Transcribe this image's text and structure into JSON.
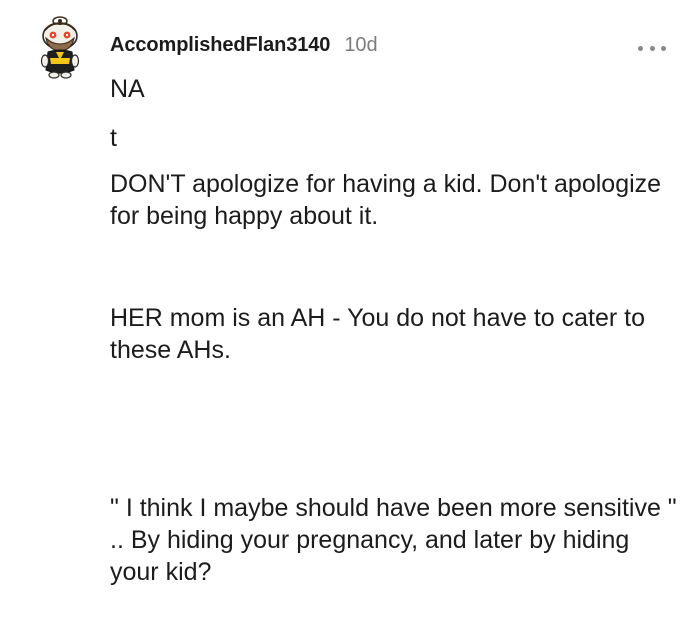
{
  "comment": {
    "username": "AccomplishedFlan3140",
    "age": "10d",
    "paragraphs": [
      "NA",
      "t",
      "DON'T apologize for having a kid. Don't apologize for being happy about it.",
      "HER mom is an AH - You do not have to cater to these AHs.",
      "\" I think I maybe should have been more sensitive \" .. By hiding your pregnancy, and later by hiding your kid?"
    ],
    "icons": {
      "avatar": "snoo-avatar",
      "more": "more-options-icon"
    }
  }
}
